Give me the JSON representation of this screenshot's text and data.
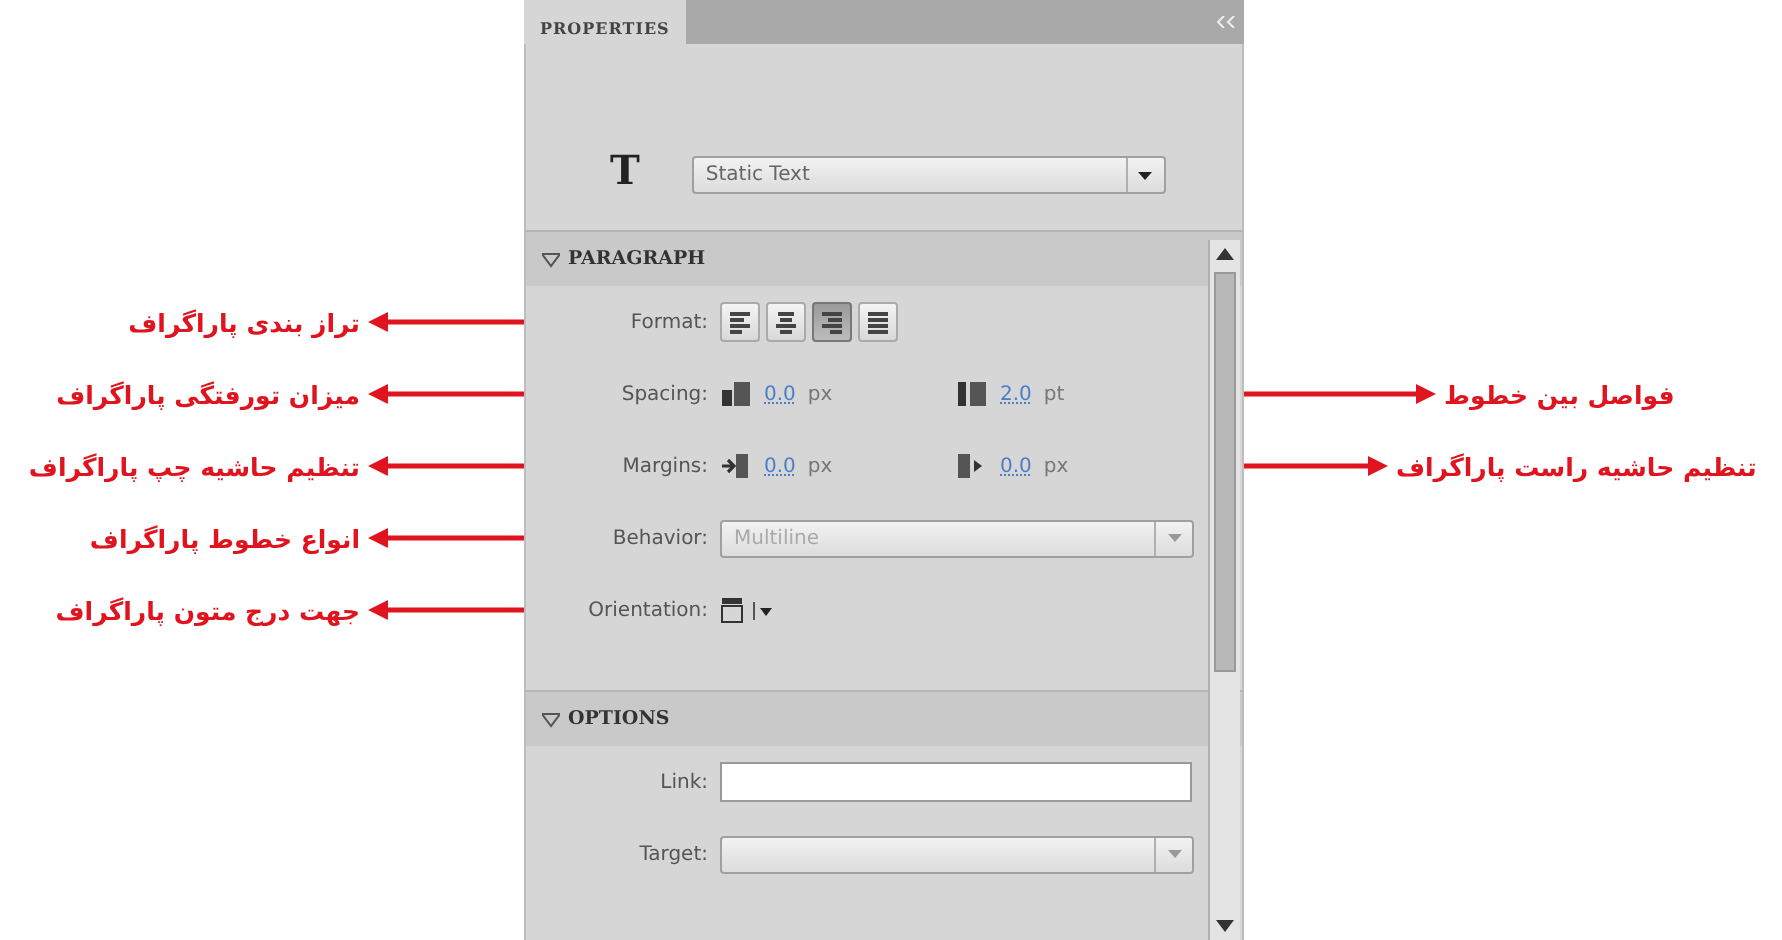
{
  "panel": {
    "tab": "PROPERTIES",
    "type_glyph": "T",
    "instance_type": "Static Text"
  },
  "sections": [
    {
      "title": "PARAGRAPH",
      "expanded": true,
      "rows": [
        {
          "kind": "format",
          "label": "Format:",
          "callout_left": "تراز بندی پاراگراف",
          "buttons": [
            {
              "selected": false
            },
            {
              "selected": false
            },
            {
              "selected": true
            },
            {
              "selected": false
            }
          ]
        },
        {
          "kind": "pair",
          "label": "Spacing:",
          "callout_left": "میزان تورفتگی پاراگراف",
          "callout_right": "فواصل بین خطوط",
          "left_field": {
            "value": "0.0",
            "unit": "px"
          },
          "right_field": {
            "value": "2.0",
            "unit": "pt"
          }
        },
        {
          "kind": "pair",
          "label": "Margins:",
          "callout_left": "تنظیم حاشیه چپ پاراگراف",
          "callout_right": "تنظیم حاشیه راست پاراگراف",
          "left_field": {
            "value": "0.0",
            "unit": "px"
          },
          "right_field": {
            "value": "0.0",
            "unit": "px"
          }
        },
        {
          "kind": "dropdown",
          "label": "Behavior:",
          "callout_left": "انواع خطوط پاراگراف",
          "value": "Multiline",
          "disabled": true
        },
        {
          "kind": "orientation",
          "label": "Orientation:",
          "callout_left": "جهت درج متون پاراگراف"
        }
      ]
    },
    {
      "title": "OPTIONS",
      "expanded": true,
      "rows": [
        {
          "kind": "text",
          "label": "Link:"
        },
        {
          "kind": "dropdown",
          "label": "Target:",
          "disabled": true
        }
      ]
    }
  ]
}
